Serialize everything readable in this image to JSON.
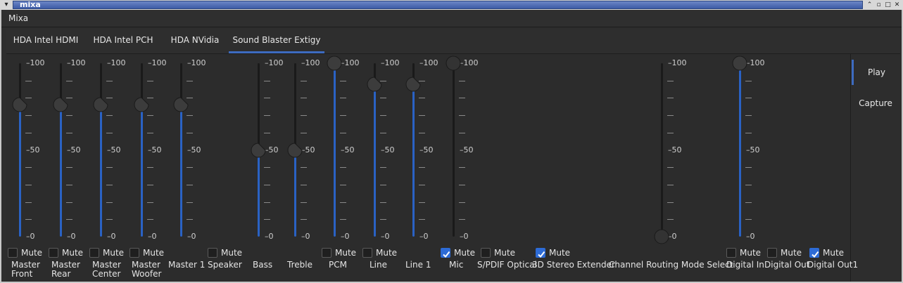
{
  "window": {
    "title": "mixa"
  },
  "menubar": {
    "app_label": "Mixa"
  },
  "tabs": [
    {
      "label": "HDA Intel HDMI",
      "active": false
    },
    {
      "label": "HDA Intel PCH",
      "active": false
    },
    {
      "label": "HDA NVidia",
      "active": false
    },
    {
      "label": "Sound Blaster Extigy",
      "active": true
    }
  ],
  "side_tabs": [
    {
      "label": "Play",
      "active": true
    },
    {
      "label": "Capture",
      "active": false
    }
  ],
  "scale": {
    "max": "100",
    "mid": "50",
    "min": "0"
  },
  "mute_label": "Mute",
  "channels": [
    {
      "name": "Master Front",
      "label_lines": [
        "Master",
        "Front"
      ],
      "level": 76,
      "muted": false,
      "enabled": true
    },
    {
      "name": "Master Rear",
      "label_lines": [
        "Master",
        "Rear"
      ],
      "level": 76,
      "muted": false,
      "enabled": true
    },
    {
      "name": "Master Center",
      "label_lines": [
        "Master",
        "Center"
      ],
      "level": 76,
      "muted": false,
      "enabled": true
    },
    {
      "name": "Master Woofer",
      "label_lines": [
        "Master",
        "Woofer"
      ],
      "level": 76,
      "muted": false,
      "enabled": true
    },
    {
      "name": "Master 1",
      "label_lines": [
        "Master 1"
      ],
      "level": 76,
      "muted": false,
      "enabled": true,
      "no_mute": true
    },
    {
      "name": "Speaker",
      "label_lines": [
        "Speaker"
      ],
      "level": null,
      "muted": false,
      "enabled": true
    },
    {
      "name": "Bass",
      "label_lines": [
        "Bass"
      ],
      "level": 50,
      "muted": false,
      "enabled": true,
      "no_mute": true
    },
    {
      "name": "Treble",
      "label_lines": [
        "Treble"
      ],
      "level": 50,
      "muted": false,
      "enabled": true,
      "no_mute": true
    },
    {
      "name": "PCM",
      "label_lines": [
        "PCM"
      ],
      "level": 100,
      "muted": false,
      "enabled": true
    },
    {
      "name": "Line",
      "label_lines": [
        "Line"
      ],
      "level": 88,
      "muted": false,
      "enabled": true
    },
    {
      "name": "Line 1",
      "label_lines": [
        "Line 1"
      ],
      "level": 88,
      "muted": false,
      "enabled": true,
      "no_mute": true
    },
    {
      "name": "Mic",
      "label_lines": [
        "Mic"
      ],
      "level": 100,
      "muted": true,
      "enabled": false
    },
    {
      "name": "S/PDIF Optical",
      "label_lines": [
        "S/PDIF Optical"
      ],
      "level": null,
      "muted": false,
      "enabled": true
    },
    {
      "name": "3D Stereo Extender",
      "label_lines": [
        "3D Stereo Extender"
      ],
      "level": null,
      "muted": true,
      "enabled": true
    },
    {
      "name": "Channel Routing Mode Select",
      "label_lines": [
        "Channel Routing Mode Select"
      ],
      "level": 0,
      "muted": false,
      "enabled": false,
      "no_mute": true
    },
    {
      "name": "Digital In",
      "label_lines": [
        "Digital In"
      ],
      "level": 100,
      "muted": false,
      "enabled": true
    },
    {
      "name": "Digital Out",
      "label_lines": [
        "Digital Out"
      ],
      "level": null,
      "muted": false,
      "enabled": true
    },
    {
      "name": "Digital Out1",
      "label_lines": [
        "Digital Out1"
      ],
      "level": null,
      "muted": true,
      "enabled": true
    }
  ]
}
